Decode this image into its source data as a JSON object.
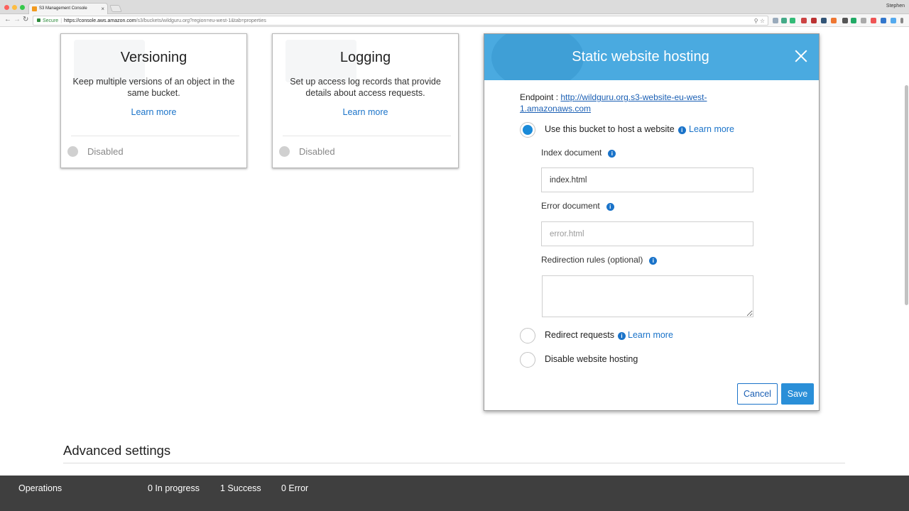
{
  "browser": {
    "tab_title": "S3 Management Console",
    "tab_close": "×",
    "user_name": "Stephen",
    "secure_label": "Secure",
    "url_host": "https://console.aws.amazon.com",
    "url_path": "/s3/buckets/wildguru.org?region=eu-west-1&tab=properties",
    "back_glyph": "←",
    "forward_glyph": "→",
    "reload_glyph": "↻",
    "zoom_glyph": "⚲",
    "star_glyph": "☆"
  },
  "cards": [
    {
      "title": "Versioning",
      "description": "Keep multiple versions of an object in the same bucket.",
      "link": "Learn more",
      "status": "Disabled"
    },
    {
      "title": "Logging",
      "description": "Set up access log records that provide details about access requests.",
      "link": "Learn more",
      "status": "Disabled"
    }
  ],
  "panel": {
    "title": "Static website hosting",
    "endpoint_label": "Endpoint : ",
    "endpoint_url": "http://wildguru.org.s3-website-eu-west-1.amazonaws.com",
    "options": [
      {
        "label": "Use this bucket to host a website",
        "link": "Learn more",
        "selected": true
      },
      {
        "label": "Redirect requests",
        "link": "Learn more",
        "selected": false
      },
      {
        "label": "Disable website hosting",
        "selected": false
      }
    ],
    "index_label": "Index document",
    "index_value": "index.html",
    "error_label": "Error document",
    "error_placeholder": "error.html",
    "redirection_label": "Redirection rules (optional)",
    "info_glyph": "i",
    "cancel": "Cancel",
    "save": "Save"
  },
  "advanced": {
    "title": "Advanced settings"
  },
  "operations": {
    "label": "Operations",
    "in_progress": "0 In progress",
    "success": "1 Success",
    "error": "0 Error"
  },
  "colors": {
    "header_blue": "#4aaae0",
    "link_blue": "#1a73c9",
    "radio_selected": "#1a8ad8",
    "save_button": "#2a8fd8",
    "ops_bar": "#3f3f3f"
  },
  "icons": [
    "close-icon",
    "info-icon",
    "lock-icon",
    "star-icon",
    "search-icon"
  ]
}
